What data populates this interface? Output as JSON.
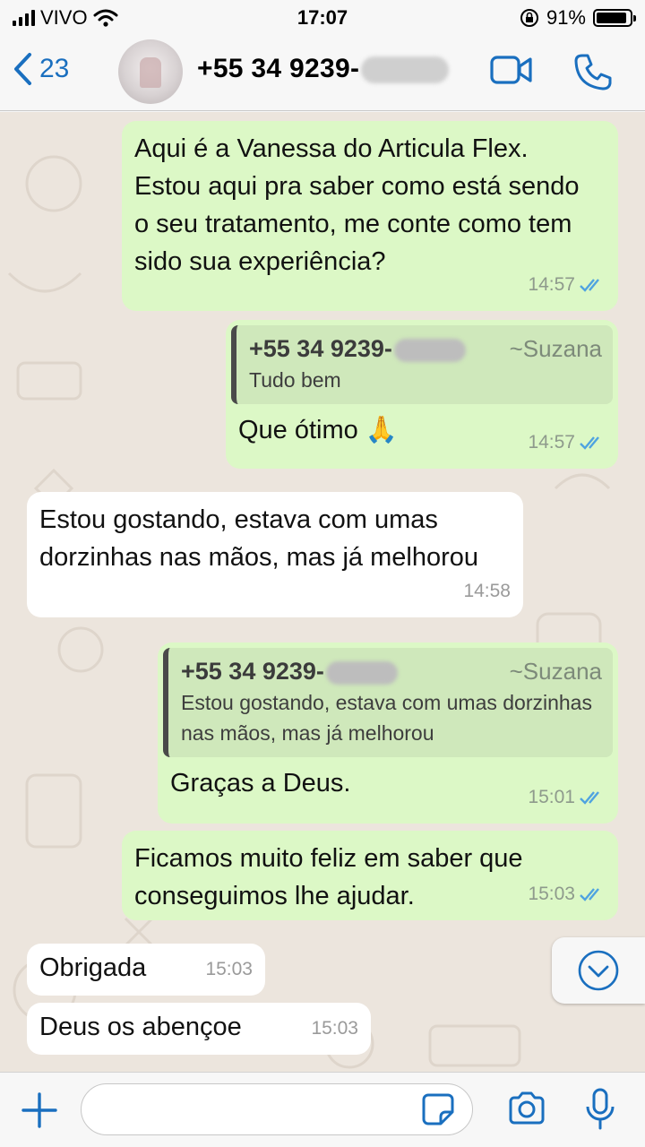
{
  "status": {
    "carrier": "VIVO",
    "time": "17:07",
    "battery": "91%",
    "battery_level": 0.91
  },
  "header": {
    "back_count": "23",
    "contact_visible": "+55 34 9239-"
  },
  "messages": [
    {
      "dir": "out",
      "text": "Aqui é a Vanessa do Articula Flex. Estou aqui pra saber como está sendo o seu tratamento, me conte como tem sido sua experiência?",
      "time": "14:57"
    },
    {
      "dir": "out",
      "quote": {
        "who": "+55 34 9239-",
        "alias": "~Suzana",
        "text": "Tudo bem"
      },
      "text": "Que ótimo 🙏",
      "time": "14:57"
    },
    {
      "dir": "in",
      "text": "Estou gostando, estava com umas dorzinhas nas mãos, mas já melhorou",
      "time": "14:58"
    },
    {
      "dir": "out",
      "quote": {
        "who": "+55 34 9239-",
        "alias": "~Suzana",
        "text": "Estou gostando, estava com umas dorzinhas nas mãos, mas já melhorou"
      },
      "text": "Graças a Deus.",
      "time": "15:01"
    },
    {
      "dir": "out",
      "text": "Ficamos muito feliz em saber que conseguimos lhe ajudar.",
      "time": "15:03"
    },
    {
      "dir": "in",
      "text": "Obrigada",
      "time": "15:03"
    },
    {
      "dir": "in",
      "text": "Deus os abençoe",
      "time": "15:03"
    }
  ],
  "input": {
    "placeholder": ""
  },
  "icons": [
    "back-chevron-icon",
    "video-call-icon",
    "phone-icon",
    "plus-icon",
    "sticker-icon",
    "camera-icon",
    "microphone-icon",
    "scroll-down-icon",
    "read-ticks-icon",
    "wifi-icon",
    "lock-rotation-icon",
    "battery-icon"
  ],
  "colors": {
    "accent": "#1a6fbf",
    "outgoing": "#dcf8c6",
    "incoming": "#ffffff",
    "chat_bg": "#ece5dd",
    "read_ticks": "#4fa3e0"
  }
}
